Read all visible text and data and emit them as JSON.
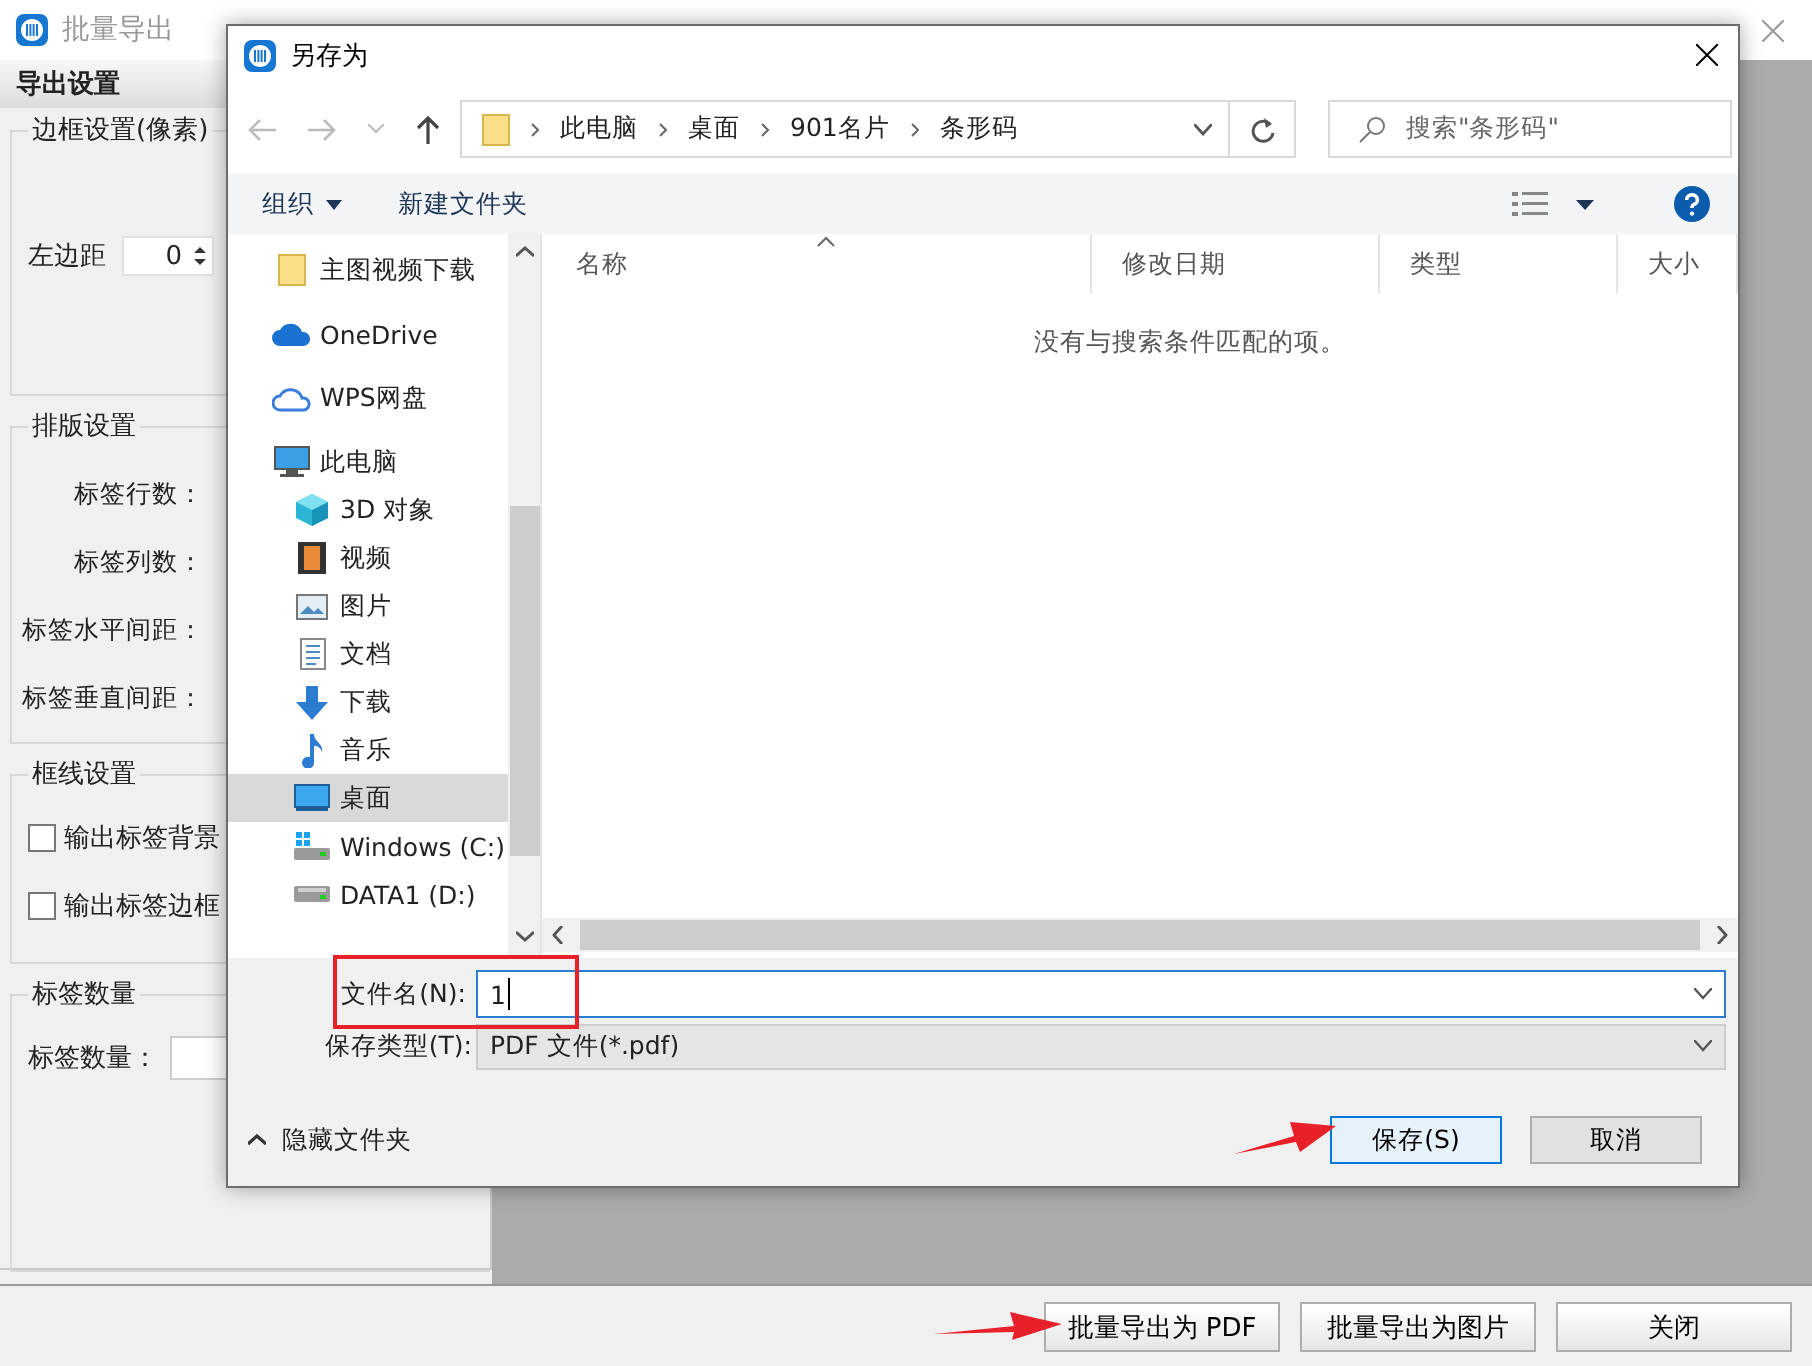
{
  "export_window": {
    "title": "批量导出",
    "heading": "导出设置",
    "border_group": {
      "title": "边框设置(像素)",
      "left_margin": {
        "label": "左边距",
        "value": "0"
      }
    },
    "layout_group": {
      "title": "排版设置",
      "fields": [
        {
          "label": "标签行数："
        },
        {
          "label": "标签列数："
        },
        {
          "label": "标签水平间距："
        },
        {
          "label": "标签垂直间距："
        }
      ]
    },
    "frame_group": {
      "title": "框线设置",
      "checkboxes": [
        {
          "label": "输出标签背景",
          "checked": false
        },
        {
          "label": "输出标签边框",
          "checked": false
        }
      ]
    },
    "count_group": {
      "title": "标签数量",
      "field": {
        "label": "标签数量："
      }
    },
    "buttons": [
      "批量导出为 PDF",
      "批量导出为图片",
      "关闭"
    ]
  },
  "save_dialog": {
    "title": "另存为",
    "breadcrumbs": [
      "此电脑",
      "桌面",
      "901名片",
      "条形码"
    ],
    "search": {
      "placeholder": "搜索\"条形码\""
    },
    "toolbar": [
      {
        "label": "组织",
        "kind": "menu"
      },
      {
        "label": "新建文件夹",
        "kind": "button"
      }
    ],
    "nav": [
      {
        "label": "主图视频下载",
        "kind": "folder",
        "selected": false
      },
      {
        "label": "OneDrive",
        "kind": "onedrive",
        "selected": false
      },
      {
        "label": "WPS网盘",
        "kind": "cloud",
        "selected": false
      },
      {
        "label": "此电脑",
        "kind": "pc",
        "selected": false,
        "children": [
          {
            "label": "3D 对象",
            "kind": "cube",
            "selected": false
          },
          {
            "label": "视频",
            "kind": "video",
            "selected": false
          },
          {
            "label": "图片",
            "kind": "picture",
            "selected": false
          },
          {
            "label": "文档",
            "kind": "document",
            "selected": false
          },
          {
            "label": "下载",
            "kind": "download",
            "selected": false
          },
          {
            "label": "音乐",
            "kind": "music",
            "selected": false
          },
          {
            "label": "桌面",
            "kind": "desktop",
            "selected": true
          },
          {
            "label": "Windows (C:)",
            "kind": "sysdrive",
            "selected": false
          },
          {
            "label": "DATA1 (D:)",
            "kind": "drive",
            "selected": false
          }
        ]
      }
    ],
    "columns": [
      "名称",
      "修改日期",
      "类型",
      "大小"
    ],
    "empty_message": "没有与搜索条件匹配的项。",
    "file_name": {
      "label": "文件名(N):",
      "value": "1"
    },
    "file_type": {
      "label": "保存类型(T):",
      "value": "PDF 文件(*.pdf)"
    },
    "hide_folders": "隐藏文件夹",
    "buttons": [
      {
        "label": "保存(S)",
        "default": true
      },
      {
        "label": "取消",
        "default": false
      }
    ]
  }
}
